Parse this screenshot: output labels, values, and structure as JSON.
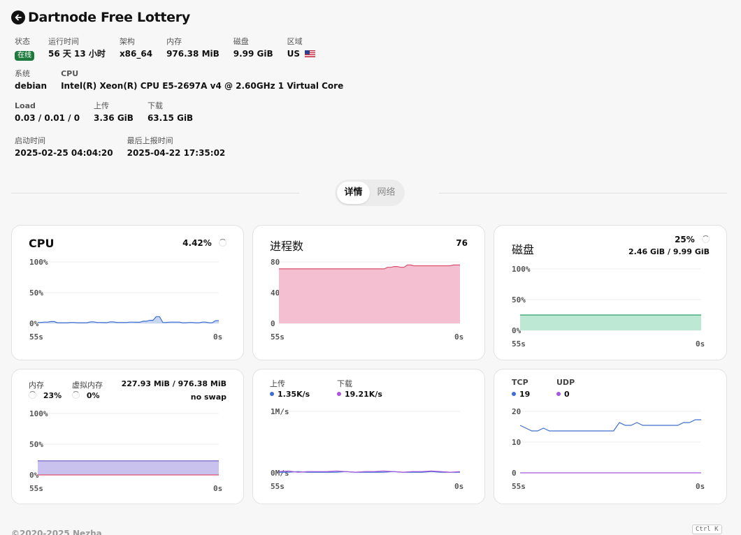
{
  "header": {
    "title": "Dartnode Free Lottery"
  },
  "info": {
    "status_label": "状态",
    "status_value": "在线",
    "uptime_label": "运行时间",
    "uptime_value": "56 天 13 小时",
    "arch_label": "架构",
    "arch_value": "x86_64",
    "mem_label": "内存",
    "mem_value": "976.38 MiB",
    "disk_label": "磁盘",
    "disk_value": "9.99 GiB",
    "region_label": "区域",
    "region_value": "US",
    "system_label": "系统",
    "system_value": "debian",
    "cpu_label": "CPU",
    "cpu_value": "Intel(R) Xeon(R) CPU E5-2697A v4 @ 2.60GHz 1 Virtual Core",
    "load_label": "Load",
    "load_value": "0.03 / 0.01 / 0",
    "upload_label": "上传",
    "upload_value": "3.36 GiB",
    "download_label": "下载",
    "download_value": "63.15 GiB",
    "boot_label": "启动时间",
    "boot_value": "2025-02-25 04:04:20",
    "last_label": "最后上报时间",
    "last_value": "2025-04-22 17:35:02"
  },
  "tabs": {
    "detail": "详情",
    "network": "网络"
  },
  "cards": {
    "cpu": {
      "title": "CPU",
      "value": "4.42%"
    },
    "process": {
      "title": "进程数",
      "value": "76"
    },
    "disk": {
      "title": "磁盘",
      "percent": "25%",
      "detail": "2.46 GiB / 9.99 GiB"
    },
    "memory": {
      "mem_label": "内存",
      "mem_percent": "23%",
      "swap_label": "虚拟内存",
      "swap_percent": "0%",
      "detail": "227.93 MiB / 976.38 MiB",
      "swap_detail": "no swap"
    },
    "network": {
      "up_label": "上传",
      "up_value": "1.35K/s",
      "down_label": "下载",
      "down_value": "19.21K/s"
    },
    "conn": {
      "tcp_label": "TCP",
      "tcp_value": "19",
      "udp_label": "UDP",
      "udp_value": "0"
    }
  },
  "colors": {
    "blue": "#3d6fd1",
    "pink": "#d9536f",
    "pink_fill": "#f4bfd0",
    "green_fill": "#bde8d3",
    "green_line": "#2f9e67",
    "purple": "#a855e0",
    "purple_fill": "#c9c2ee",
    "badge": "#1e7a3c"
  },
  "footer": {
    "copyright": "©2020-2025 Nezha",
    "shortcut": "Ctrl K"
  },
  "chart_data": [
    {
      "type": "area",
      "name": "cpu",
      "x_start_label": "55s",
      "x_end_label": "0s",
      "yticks": [
        "100%",
        "50%",
        "0%"
      ],
      "ylim": [
        0,
        100
      ],
      "values": [
        1.5,
        1.5,
        2,
        2,
        3,
        3,
        1,
        1,
        1,
        1,
        1.5,
        1.5,
        1,
        1,
        1,
        1,
        2.5,
        2.5,
        1.5,
        1.5,
        1.2,
        1.2,
        2.5,
        2.5,
        1.5,
        1.5,
        1.5,
        1.5,
        2,
        2,
        1.8,
        1.8,
        3.5,
        3.5,
        5,
        5,
        11,
        11,
        1.5,
        1.5,
        2,
        2,
        2,
        2,
        1,
        1,
        1.5,
        1.5,
        1,
        1,
        2,
        2,
        1,
        1,
        4.42,
        4.42
      ]
    },
    {
      "type": "area",
      "name": "process",
      "x_start_label": "55s",
      "x_end_label": "0s",
      "yticks": [
        "80",
        "40",
        "0"
      ],
      "ylim": [
        0,
        80
      ],
      "values": [
        71,
        71,
        71,
        71,
        71,
        71,
        71,
        71,
        71,
        71,
        71,
        71,
        71,
        71,
        71,
        71,
        71,
        71,
        71,
        71,
        71,
        71,
        71,
        71,
        71,
        71,
        71,
        71,
        71,
        71,
        71,
        71,
        71,
        73,
        73,
        74,
        74,
        73,
        73,
        76,
        76,
        75,
        75,
        75,
        75,
        75,
        75,
        75,
        75,
        75,
        75,
        75,
        75,
        76,
        76,
        76
      ]
    },
    {
      "type": "area",
      "name": "disk",
      "x_start_label": "55s",
      "x_end_label": "0s",
      "yticks": [
        "100%",
        "50%",
        "0%"
      ],
      "ylim": [
        0,
        100
      ],
      "values": [
        25,
        25
      ]
    },
    {
      "type": "area",
      "name": "memory",
      "x_start_label": "55s",
      "x_end_label": "0s",
      "yticks": [
        "100%",
        "50%",
        "0%"
      ],
      "ylim": [
        0,
        100
      ],
      "series": [
        {
          "name": "内存",
          "values": [
            23,
            23
          ]
        },
        {
          "name": "虚拟内存",
          "values": [
            0,
            0
          ]
        }
      ]
    },
    {
      "type": "line",
      "name": "network",
      "x_start_label": "55s",
      "x_end_label": "0s",
      "yticks": [
        "1M/s",
        "0M/s"
      ],
      "ylim": [
        0,
        1
      ],
      "series": [
        {
          "name": "上传",
          "values": [
            0.01,
            0.01,
            0.02,
            0.01,
            0.01,
            0.01,
            0.01,
            0.02,
            0.01,
            0.01,
            0.01,
            0.01,
            0.02,
            0.01,
            0.01,
            0.01,
            0.02,
            0.01,
            0.01,
            0.01
          ]
        },
        {
          "name": "下载",
          "values": [
            0.02,
            0.03,
            0.01,
            0.02,
            0.02,
            0.02,
            0.03,
            0.02,
            0.01,
            0.02,
            0.02,
            0.03,
            0.02,
            0.01,
            0.02,
            0.02,
            0.03,
            0.02,
            0.01,
            0.02
          ]
        }
      ]
    },
    {
      "type": "line",
      "name": "connections",
      "x_start_label": "55s",
      "x_end_label": "0s",
      "yticks": [
        "20",
        "10",
        "0"
      ],
      "ylim": [
        0,
        22
      ],
      "series": [
        {
          "name": "TCP",
          "values": [
            17,
            16,
            15,
            15,
            16,
            15,
            15,
            15,
            15,
            15,
            15,
            15,
            15,
            15,
            15,
            15,
            15,
            18,
            17,
            17,
            18,
            17,
            17,
            17,
            17,
            17,
            17,
            17,
            18,
            18,
            19,
            19
          ]
        },
        {
          "name": "UDP",
          "values": [
            0,
            0
          ]
        }
      ]
    }
  ]
}
